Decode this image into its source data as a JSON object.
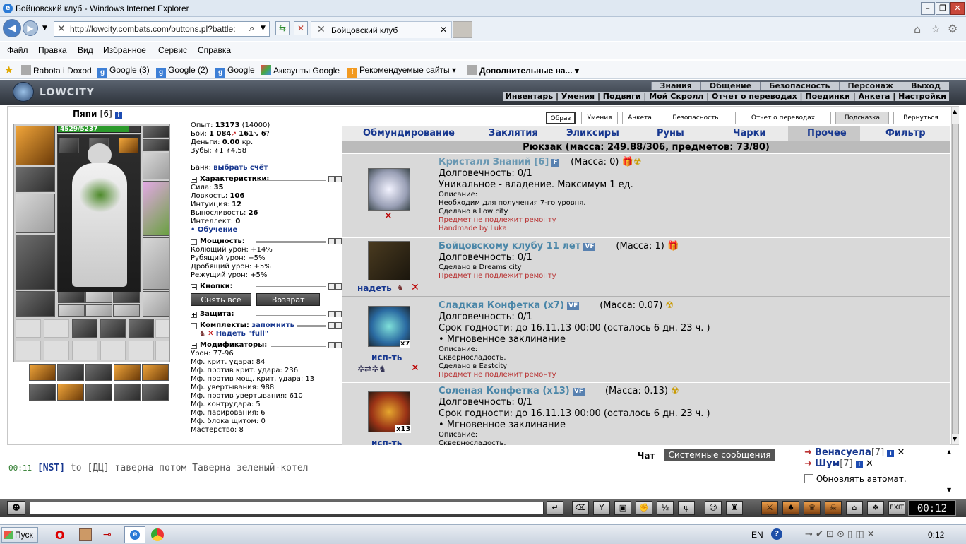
{
  "window": {
    "title": "Бойцовский клуб - Windows Internet Explorer"
  },
  "browser": {
    "url": "http://lowcity.combats.com/buttons.pl?battle:",
    "tab_title": "Бойцовский клуб",
    "menu": [
      "Файл",
      "Правка",
      "Вид",
      "Избранное",
      "Сервис",
      "Справка"
    ],
    "favorites": [
      "Rabota i Doxod",
      "Google (3)",
      "Google (2)",
      "Google",
      "Аккаунты Google",
      "Рекомендуемые сайты ▾",
      "Дополнительные на... ▾"
    ]
  },
  "game": {
    "logo": "LOWCITY",
    "top_links": [
      "Знания",
      "Общение",
      "Безопасность",
      "Персонаж",
      "Выход"
    ],
    "sub_links": "Инвентарь | Умения | Подвиги | Мой Скролл | Отчет о переводах | Поединки | Анкета | Настройки",
    "right_tabs": [
      "Образ",
      "Умения",
      "Анкета",
      "Безопасность",
      "Отчет о переводах",
      "Подсказка",
      "Вернуться"
    ],
    "character": {
      "name": "Пяпи",
      "level": "[6]",
      "hp": "4529/5237",
      "hp_fraction": 0.865
    },
    "stats": {
      "exp_label": "Опыт:",
      "exp": "13173",
      "exp_next": "(14000)",
      "fights_label": "Бои:",
      "fights_win": "1 084",
      "fights_lose": "161",
      "fights_draw": "6",
      "money_label": "Деньги:",
      "money": "0.00",
      "money_unit": "кр.",
      "teeth_label": "Зубы:",
      "teeth": "1",
      "teeth2": "4.58",
      "bank_label": "Банк:",
      "bank_link": "выбрать счёт"
    },
    "characteristics": {
      "title": "Характеристики:",
      "rows": [
        {
          "label": "Сила:",
          "value": "35"
        },
        {
          "label": "Ловкость:",
          "value": "106"
        },
        {
          "label": "Интуиция:",
          "value": "12"
        },
        {
          "label": "Выносливость:",
          "value": "26"
        },
        {
          "label": "Интеллект:",
          "value": "0"
        }
      ],
      "learning": "• Обучение"
    },
    "powers": {
      "title": "Мощность:",
      "rows": [
        "Колющий урон: +14%",
        "Рубящий урон: +5%",
        "Дробящий урон: +5%",
        "Режущий урон: +5%"
      ]
    },
    "buttons": {
      "title": "Кнопки:",
      "remove_all": "Снять всё",
      "return": "Возврат"
    },
    "protection": {
      "title": "Защита:"
    },
    "sets": {
      "title": "Комплекты:",
      "remember": "запомнить",
      "wear": "Надеть \"full\""
    },
    "modifiers": {
      "title": "Модификаторы:",
      "rows": [
        "Урон: 77-96",
        "Мф. крит. удара: 84",
        "Мф. против крит. удара: 236",
        "Мф. против мощ. крит. удара: 13",
        "Мф. увертывания: 988",
        "Мф. против увертывания: 610",
        "Мф. контрудара: 5",
        "Мф. парирования: 6",
        "Мф. блока щитом: 0",
        "Мастерство: 8"
      ]
    },
    "inventory_tabs": [
      "Обмундирование",
      "Заклятия",
      "Эликсиры",
      "Руны",
      "Чарки",
      "Прочее",
      "Фильтр"
    ],
    "inventory_active_tab": "Прочее",
    "backpack": "Рюкзак (масса: 249.88/306, предметов: 73/80)",
    "items": [
      {
        "name": "Кристалл Знаний [6]",
        "tag": "F",
        "mass": "(Масса: 0)",
        "lines": [
          "Долговечность: 0/1",
          "Уникальное - владение. Максимум 1 ед."
        ],
        "small": [
          "Описание:",
          "Необходим для получения 7-го уровня.",
          "Сделано в Low city"
        ],
        "red": [
          "Предмет не подлежит ремонту",
          "Handmade by Luka"
        ],
        "action": "",
        "count": ""
      },
      {
        "name": "Бойцовскому клубу 11 лет",
        "tag": "VF",
        "mass": "(Масса: 1)",
        "lines": [
          "Долговечность: 0/1"
        ],
        "small": [
          "Сделано в Dreams city"
        ],
        "red": [
          "Предмет не подлежит ремонту"
        ],
        "action": "надеть",
        "count": ""
      },
      {
        "name": "Сладкая Конфетка (x7)",
        "tag": "VF",
        "mass": "(Масса: 0.07)",
        "lines": [
          "Долговечность: 0/1",
          "Срок годности: до 16.11.13 00:00 (осталось 6 дн. 23 ч. )",
          "• Мгновенное заклинание"
        ],
        "small": [
          "Описание:",
          "Скверносладость.",
          "Сделано в Eastcity"
        ],
        "red": [
          "Предмет не подлежит ремонту"
        ],
        "action": "исп-ть",
        "count": "x7"
      },
      {
        "name": "Соленая Конфетка (x13)",
        "tag": "VF",
        "mass": "(Масса: 0.13)",
        "lines": [
          "Долговечность: 0/1",
          "Срок годности: до 16.11.13 00:00 (осталось 6 дн. 23 ч. )",
          "• Мгновенное заклинание"
        ],
        "small": [
          "Описание:",
          "Скверносладость."
        ],
        "red": [],
        "action": "исп-ть",
        "count": "x13"
      }
    ]
  },
  "chat": {
    "tabs": [
      "Чат",
      "Системные сообщения"
    ],
    "time": "00:11",
    "sender": "[NST]",
    "to": "to",
    "message": "[ДЦ] таверна потом Таверна зеленый-котел",
    "users": [
      {
        "name": "Венасуела",
        "level": "[7]"
      },
      {
        "name": "Шум",
        "level": "[7]"
      }
    ],
    "auto_update": "Обновлять автомат.",
    "clock": "00:12"
  },
  "taskbar": {
    "start": "Пуск",
    "lang": "EN",
    "time": "0:12"
  },
  "colors": {
    "link_blue": "#17378f",
    "item_name": "#4a86a8",
    "repair_red": "#b83232",
    "hp_green": "#2b9a2b"
  }
}
